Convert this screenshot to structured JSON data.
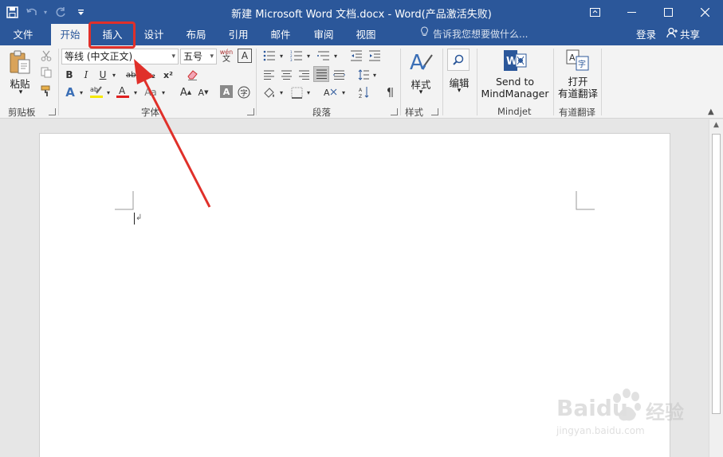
{
  "titlebar": {
    "title": "新建 Microsoft Word 文档.docx - Word(产品激活失败)",
    "save_icon": "save-icon",
    "undo_icon": "undo-icon",
    "redo_icon": "redo-icon",
    "customize_icon": "qat-customize-icon",
    "ribbon_display_icon": "ribbon-display-icon",
    "minimize_icon": "minimize-icon",
    "maximize_icon": "maximize-icon",
    "close_icon": "close-icon"
  },
  "tabs": [
    {
      "label": "文件"
    },
    {
      "label": "开始",
      "active": true
    },
    {
      "label": "插入"
    },
    {
      "label": "设计"
    },
    {
      "label": "布局"
    },
    {
      "label": "引用"
    },
    {
      "label": "邮件"
    },
    {
      "label": "审阅"
    },
    {
      "label": "视图"
    }
  ],
  "tellme": {
    "text": "告诉我您想要做什么..."
  },
  "account": {
    "signin": "登录",
    "share": "共享"
  },
  "ribbon": {
    "clipboard": {
      "paste": "粘贴",
      "label": "剪贴板"
    },
    "font": {
      "font_name": "等线 (中文正文)",
      "font_size": "五号",
      "phonetic": "wén",
      "bold": "B",
      "italic": "I",
      "underline": "U",
      "strikethrough": "abc",
      "subscript": "x₂",
      "superscript": "x²",
      "label": "字体"
    },
    "paragraph": {
      "label": "段落"
    },
    "styles": {
      "button": "样式",
      "label": "样式"
    },
    "editing": {
      "button": "编辑"
    },
    "mindjet": {
      "button_line1": "Send to",
      "button_line2": "MindManager",
      "label": "Mindjet"
    },
    "youdao": {
      "button_line1": "打开",
      "button_line2": "有道翻译",
      "label": "有道翻译"
    }
  },
  "watermark": {
    "brand": "Baidu",
    "brand_cn": "经验",
    "url": "jingyan.baidu.com"
  },
  "colors": {
    "accent": "#2b579a",
    "highlight_box": "#e0302a",
    "arrow": "#e0302a"
  }
}
